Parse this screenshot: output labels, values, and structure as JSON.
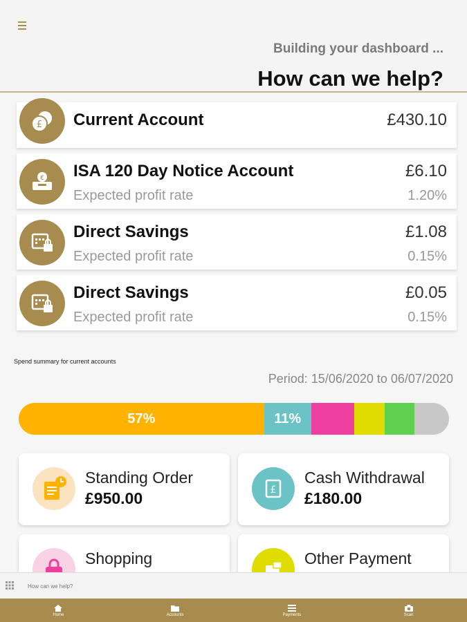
{
  "header": {
    "menu_icon": "hamburger-icon",
    "loading_text": "Building your dashboard ...",
    "title": "How can we help?"
  },
  "accounts": [
    {
      "name": "Current Account",
      "amount": "£430.10",
      "icon": "coins-icon"
    },
    {
      "name": "ISA 120 Day Notice Account",
      "amount": "£6.10",
      "sub_label": "Expected profit rate",
      "rate": "1.20%",
      "icon": "piggy-bank-icon"
    },
    {
      "name": "Direct Savings",
      "amount": "£1.08",
      "sub_label": "Expected profit rate",
      "rate": "0.15%",
      "icon": "calendar-lock-icon"
    },
    {
      "name": "Direct Savings",
      "amount": "£0.05",
      "sub_label": "Expected profit rate",
      "rate": "0.15%",
      "icon": "calendar-lock-icon"
    }
  ],
  "spend": {
    "label": "Spend summary for current accounts",
    "period": "Period: 15/06/2020 to 06/07/2020",
    "segments": [
      {
        "label": "57%",
        "share": 57,
        "color": "#ffb300"
      },
      {
        "label": "11%",
        "share": 11,
        "color": "#6cc3c5"
      },
      {
        "label": "",
        "share": 10,
        "color": "#ee3fa0"
      },
      {
        "label": "",
        "share": 7,
        "color": "#e1dc00"
      },
      {
        "label": "",
        "share": 7,
        "color": "#5fd04f"
      },
      {
        "label": "",
        "share": 8,
        "color": "#c8c8c8"
      }
    ],
    "categories": [
      {
        "name": "Standing Order",
        "amount": "£950.00",
        "color": "#ffb300",
        "icon": "standing-order-icon"
      },
      {
        "name": "Cash Withdrawal",
        "amount": "£180.00",
        "color": "#6cc3c5",
        "icon": "cash-withdrawal-icon"
      },
      {
        "name": "Shopping",
        "amount": "",
        "color": "#ee3fa0",
        "icon": "shopping-bag-icon"
      },
      {
        "name": "Other Payment",
        "amount": "",
        "color": "#e1dc00",
        "icon": "other-payment-icon"
      }
    ]
  },
  "help_bar": {
    "placeholder": "How can we help?",
    "icon": "grid-icon"
  },
  "tabs": [
    {
      "label": "Home",
      "icon": "home-icon"
    },
    {
      "label": "Accounts",
      "icon": "folder-icon"
    },
    {
      "label": "Payments",
      "icon": "list-icon"
    },
    {
      "label": "Scan",
      "icon": "camera-icon"
    }
  ],
  "colors": {
    "brand_gold": "#a88b4e",
    "header_rule": "#c9b58d"
  }
}
